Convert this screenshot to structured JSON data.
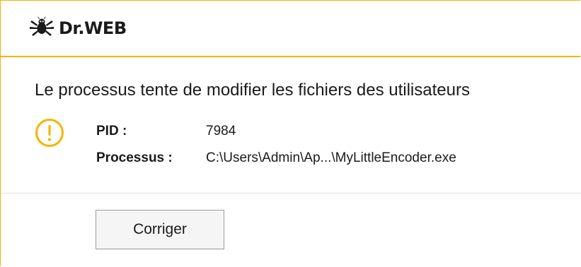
{
  "header": {
    "brand": "Dr.WEB",
    "logo_icon": "spider-icon",
    "accent": "#f5b400"
  },
  "alert": {
    "title": "Le processus tente de modifier les fichiers des utilisateurs",
    "icon": "warning-icon",
    "fields": [
      {
        "label": "PID :",
        "value": "7984"
      },
      {
        "label": "Processus :",
        "value": "C:\\Users\\Admin\\Ap...\\MyLittleEncoder.exe"
      }
    ]
  },
  "actions": {
    "fix_label": "Corriger"
  }
}
